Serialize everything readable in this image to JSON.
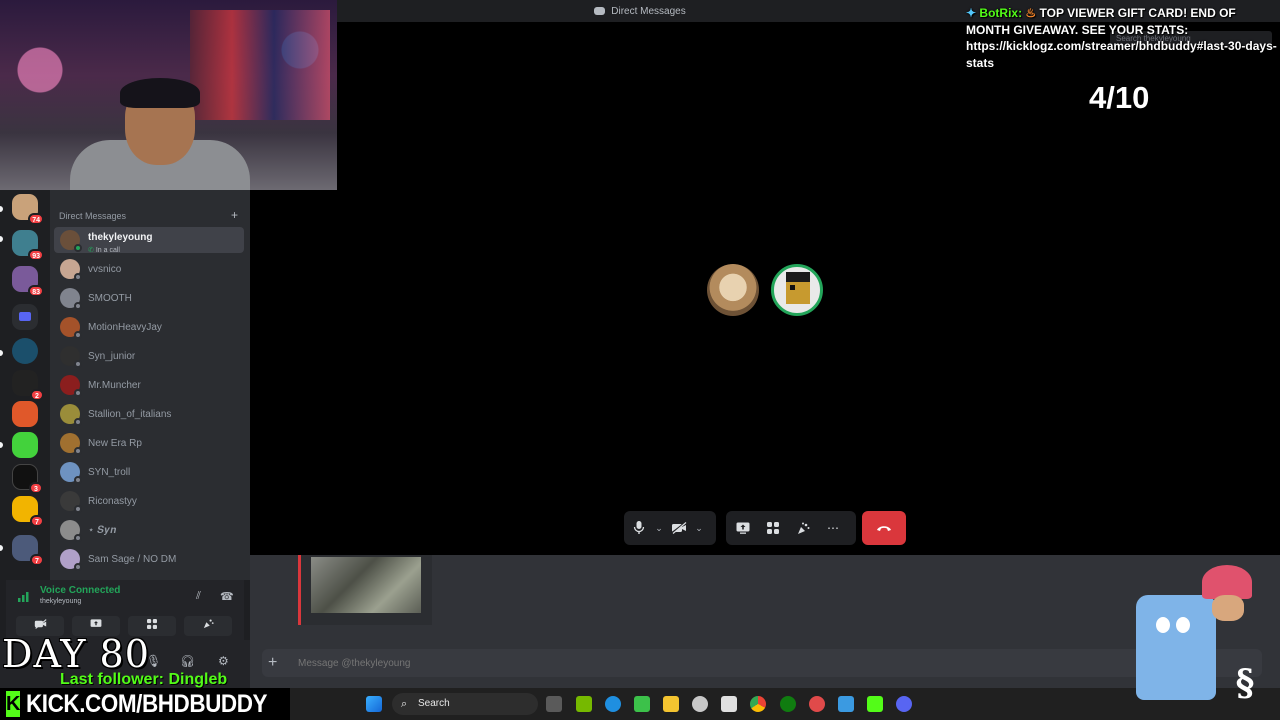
{
  "window": {
    "title": "Direct Messages"
  },
  "search": {
    "placeholder": "Search thekyleyoung"
  },
  "server_rail": {
    "badges": [
      "74",
      "93",
      "83",
      "2",
      "3",
      "7",
      "7"
    ]
  },
  "dm_list": {
    "header": "Direct Messages",
    "add_label": "+",
    "items": [
      {
        "name": "thekyleyoung",
        "sub": "In a call",
        "active": true
      },
      {
        "name": "vvsnico"
      },
      {
        "name": "SMOOTH"
      },
      {
        "name": "MotionHeavyJay"
      },
      {
        "name": "Syn_junior"
      },
      {
        "name": "Mr.Muncher"
      },
      {
        "name": "Stallion_of_italians"
      },
      {
        "name": "New Era Rp"
      },
      {
        "name": "SYN_troll"
      },
      {
        "name": "Riconastyy"
      },
      {
        "name": "⋆ 𝑺𝒚𝒏"
      },
      {
        "name": "Sam Sage / NO DM"
      }
    ]
  },
  "voice_panel": {
    "title": "Voice Connected",
    "channel": "thekyleyoung"
  },
  "composer": {
    "placeholder": "Message @thekyleyoung"
  },
  "taskbar": {
    "search_label": "Search"
  },
  "overlay": {
    "botrix_name": "BotRix:",
    "botrix_message": "TOP VIEWER GIFT CARD! END OF MONTH GIVEAWAY. SEE YOUR STATS: https://kicklogz.com/streamer/bhdbuddy#last-30-days-stats",
    "counter": "4/10",
    "day": "DAY 80",
    "last_follower": "Last follower: Dingleb",
    "kick_url": "KICK.COM/BHDBUDDY",
    "kick_green": "#53fc18"
  },
  "colors": {
    "hangup": "#da373c",
    "online": "#23a55a",
    "badge": "#f23f43"
  }
}
